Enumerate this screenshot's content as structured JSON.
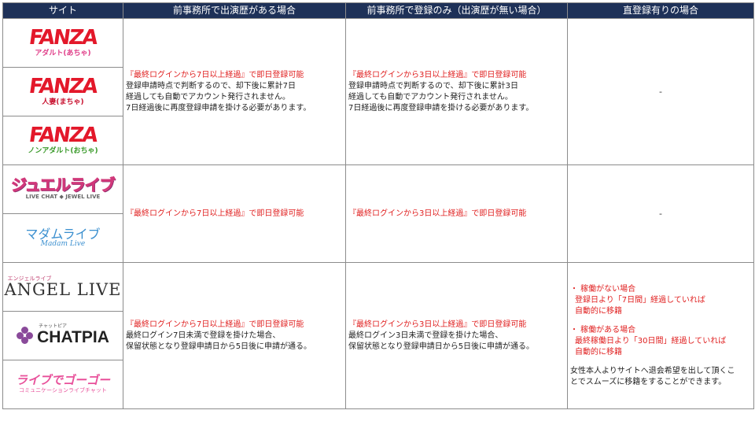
{
  "headers": {
    "site": "サイト",
    "prev_with_appearance": "前事務所で出演歴がある場合",
    "prev_registration_only": "前事務所で登録のみ（出演歴が無い場合）",
    "direct_registration": "直登録有りの場合"
  },
  "logos": {
    "fanza_word": "FANZA",
    "fanza_adult": "アダルト(あちゃ)",
    "fanza_wife": "人妻(まちゃ)",
    "fanza_nonadult": "ノンアダルト(おちゃ)",
    "jewel_main": "ジュエルライブ",
    "jewel_sub": "LIVE CHAT ◆ JEWEL LIVE",
    "madam_main": "マダムライブ",
    "madam_sub": "Madam Live",
    "angel_kana": "エンジェルライブ",
    "angel_main": "ANGEL LIVE",
    "chatpia_kana": "チャットピア",
    "chatpia_main": "CHATPIA",
    "lifebuddy_main": "ライブでゴーゴー",
    "lifebuddy_sub": "コミュニケーションライブチャット"
  },
  "group1": {
    "col1": [
      "『最終ログインから7日以上経過』で即日登録可能",
      "登録申請時点で判断するので、却下後に累計7日",
      "経過しても自動でアカウント発行されません。",
      "7日経過後に再度登録申請を掛ける必要があります。"
    ],
    "col2": [
      "『最終ログインから3日以上経過』で即日登録可能",
      "登録申請時点で判断するので、却下後に累計3日",
      "経過しても自動でアカウント発行されません。",
      "7日経過後に再度登録申請を掛ける必要があります。"
    ],
    "col3": "-"
  },
  "group2": {
    "col1": "『最終ログインから7日以上経過』で即日登録可能",
    "col2": "『最終ログインから3日以上経過』で即日登録可能",
    "col3": "-"
  },
  "group3": {
    "col1": [
      "『最終ログインから7日以上経過』で即日登録可能",
      "最終ログイン7日未満で登録を掛けた場合、",
      "保留状態となり登録申請日から5日後に申請が通る。"
    ],
    "col2": [
      "『最終ログインから3日以上経過』で即日登録可能",
      "最終ログイン3日未満で登録を掛けた場合、",
      "保留状態となり登録申請日から5日後に申請が通る。"
    ],
    "col3": [
      "・ 稼働がない場合",
      "登録日より「7日間」経過していれば",
      "自動的に移籍",
      "・ 稼働がある場合",
      "最終稼働日より「30日間」経過していれば",
      "自動的に移籍",
      "女性本人よりサイトへ退会希望を出して頂くこ",
      "とでスムーズに移籍をすることができます。"
    ]
  },
  "colors": {
    "header_bg": "#1e3158",
    "highlight_text": "#e02020",
    "fanza_red": "#e3182a"
  }
}
